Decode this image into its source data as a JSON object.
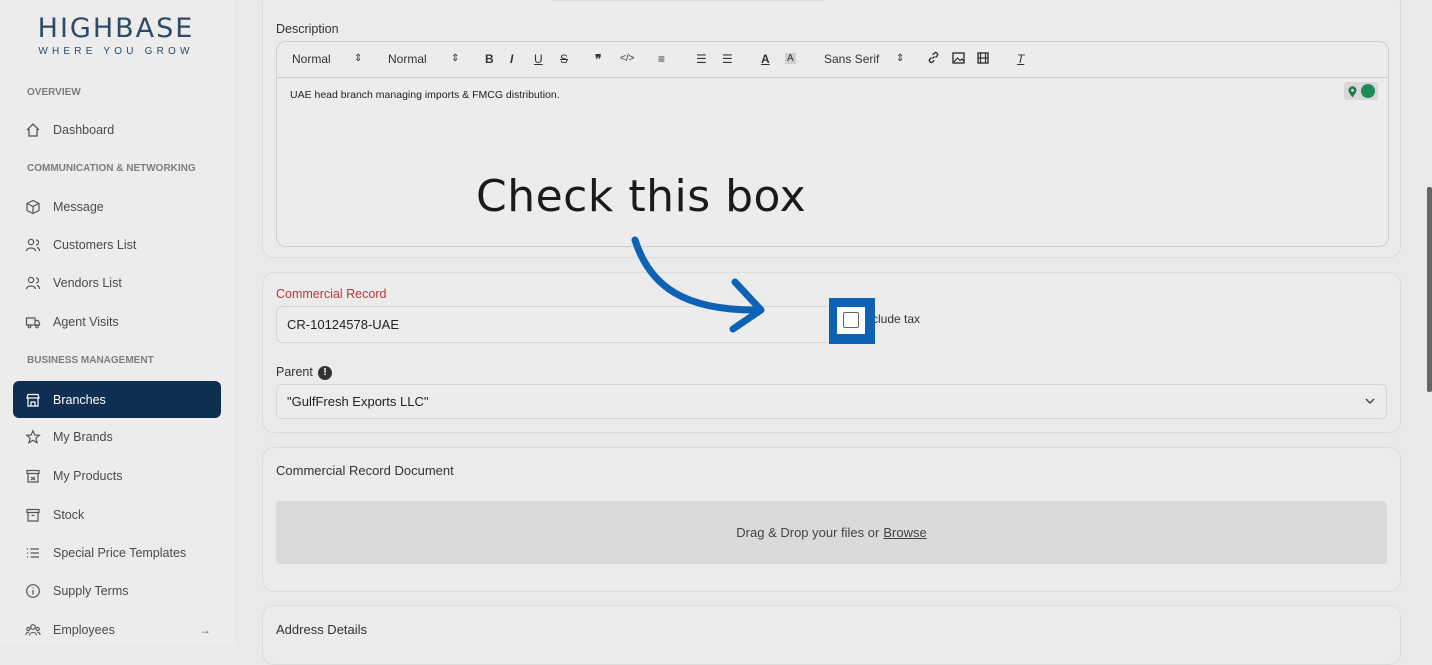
{
  "brand": {
    "name": "HIGHBASE",
    "tagline": "WHERE YOU GROW"
  },
  "sidebar": {
    "sections": {
      "overview": "OVERVIEW",
      "communication": "COMMUNICATION & NETWORKING",
      "business": "BUSINESS MANAGEMENT"
    },
    "items": [
      {
        "label": "Dashboard",
        "icon": "home-icon"
      },
      {
        "label": "Message",
        "icon": "cube-icon"
      },
      {
        "label": "Customers List",
        "icon": "users-icon"
      },
      {
        "label": "Vendors List",
        "icon": "users-icon"
      },
      {
        "label": "Agent Visits",
        "icon": "truck-icon"
      },
      {
        "label": "Branches",
        "icon": "store-icon",
        "active": true
      },
      {
        "label": "My Brands",
        "icon": "star-icon"
      },
      {
        "label": "My Products",
        "icon": "box-icon"
      },
      {
        "label": "Stock",
        "icon": "archive-icon"
      },
      {
        "label": "Special Price Templates",
        "icon": "list-icon"
      },
      {
        "label": "Supply Terms",
        "icon": "info-icon"
      },
      {
        "label": "Employees",
        "icon": "team-icon",
        "arrow": "→"
      }
    ],
    "active_color": "#0e2f52"
  },
  "description": {
    "label": "Description",
    "toolbar": {
      "header_select": "Normal",
      "size_select": "Normal",
      "font_select": "Sans Serif"
    },
    "content": "UAE head branch managing imports & FMCG distribution."
  },
  "commercial_record": {
    "label": "Commercial Record",
    "value": "CR-10124578-UAE",
    "include_tax_label": "Include tax",
    "include_tax_checked": false
  },
  "parent": {
    "label": "Parent",
    "value": "\"GulfFresh Exports LLC\""
  },
  "cr_document": {
    "title": "Commercial Record Document",
    "drop_text": "Drag & Drop your files or",
    "browse_label": "Browse"
  },
  "address": {
    "title": "Address Details"
  },
  "callout": {
    "text": "Check this box",
    "arrow_color": "#0d62b5"
  }
}
